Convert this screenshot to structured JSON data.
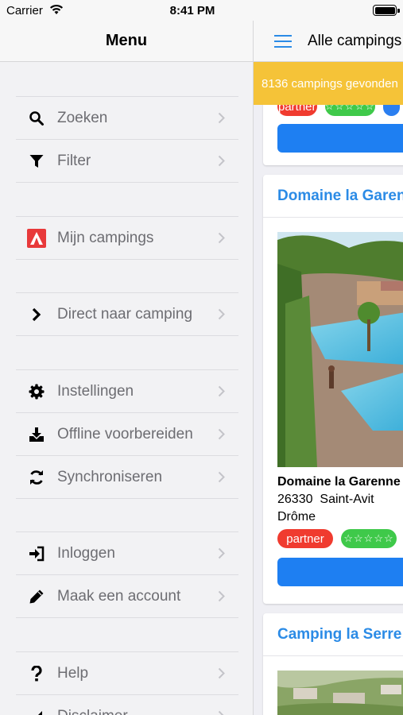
{
  "status_bar": {
    "carrier": "Carrier",
    "time": "8:41 PM"
  },
  "menu": {
    "title": "Menu",
    "groups": [
      {
        "items": [
          {
            "label": "Zoeken",
            "icon": "search-icon"
          },
          {
            "label": "Filter",
            "icon": "filter-icon"
          }
        ]
      },
      {
        "items": [
          {
            "label": "Mijn campings",
            "icon": "tent-icon"
          }
        ]
      },
      {
        "items": [
          {
            "label": "Direct naar camping",
            "icon": "chevron-right-icon"
          }
        ]
      },
      {
        "items": [
          {
            "label": "Instellingen",
            "icon": "gear-icon"
          },
          {
            "label": "Offline voorbereiden",
            "icon": "download-icon"
          },
          {
            "label": "Synchroniseren",
            "icon": "sync-icon"
          }
        ]
      },
      {
        "items": [
          {
            "label": "Inloggen",
            "icon": "login-icon"
          },
          {
            "label": "Maak een account",
            "icon": "pencil-icon"
          }
        ]
      },
      {
        "items": [
          {
            "label": "Help",
            "icon": "question-icon"
          },
          {
            "label": "Disclaimer",
            "icon": "disclaimer-icon"
          }
        ]
      }
    ]
  },
  "content": {
    "nav_title": "Alle campings",
    "banner": "8136 campings gevonden",
    "cards": [
      {
        "title": "",
        "badges": [
          "partner",
          "☆☆☆☆☆"
        ]
      },
      {
        "title": "Domaine la Garenne",
        "name": "Domaine la Garenne",
        "postal": "26330",
        "city": "Saint-Avit",
        "region": "Drôme",
        "badges": [
          "partner",
          "☆☆☆☆☆"
        ]
      },
      {
        "title": "Camping la Serre"
      }
    ]
  },
  "colors": {
    "accent": "#2b8be6",
    "banner": "#f5c338",
    "partner": "#f03b2f",
    "stars": "#3fc94a",
    "button": "#1e7ff2"
  }
}
